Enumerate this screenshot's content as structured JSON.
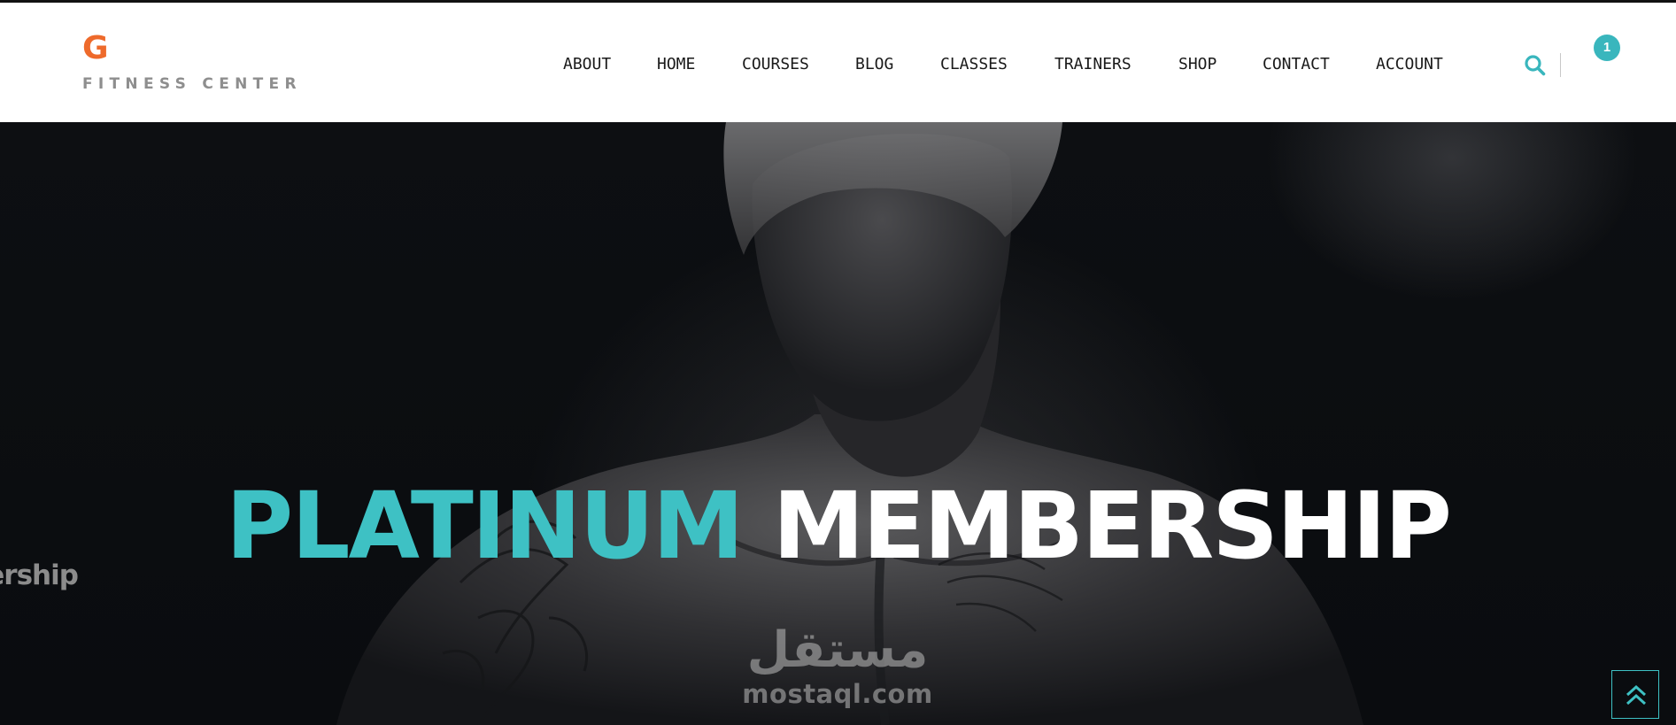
{
  "brand": {
    "logo_letter": "G",
    "name": "FITNESS CENTER",
    "accent_color": "#ee6a2b"
  },
  "nav": {
    "items": [
      {
        "label": "ABOUT"
      },
      {
        "label": "HOME"
      },
      {
        "label": "COURSES"
      },
      {
        "label": "BLOG"
      },
      {
        "label": "CLASSES"
      },
      {
        "label": "TRAINERS"
      },
      {
        "label": "SHOP"
      },
      {
        "label": "CONTACT"
      },
      {
        "label": "ACCOUNT"
      }
    ]
  },
  "header_actions": {
    "search_icon": "search-icon",
    "cart_count": "1",
    "badge_color": "#39b6bd"
  },
  "hero": {
    "title_accent": "PLATINUM",
    "title_rest": "MEMBERSHIP",
    "accent_color": "#3ec1c4",
    "side_caption": "nbership"
  },
  "watermark": {
    "arabic": "مستقل",
    "latin": "mostaql.com"
  },
  "back_to_top": {
    "icon": "double-chevron-up-icon"
  }
}
